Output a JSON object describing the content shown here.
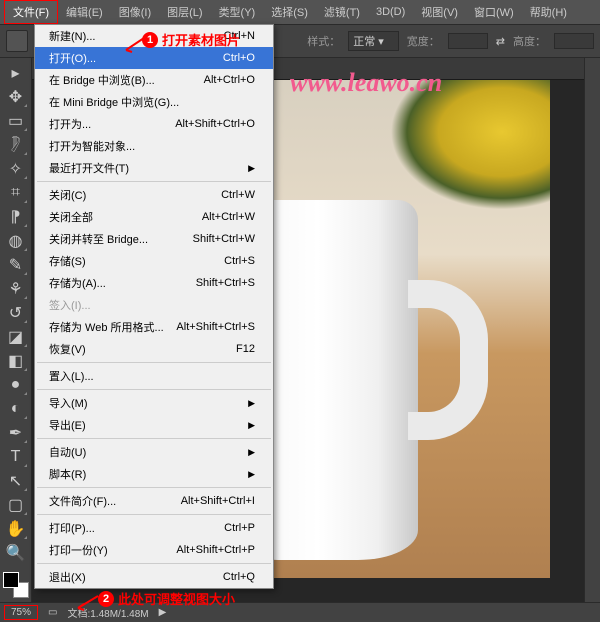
{
  "menubar": {
    "items": [
      "文件(F)",
      "编辑(E)",
      "图像(I)",
      "图层(L)",
      "类型(Y)",
      "选择(S)",
      "滤镜(T)",
      "3D(D)",
      "视图(V)",
      "窗口(W)",
      "帮助(H)"
    ]
  },
  "optionbar": {
    "style_label": "样式：",
    "style_value": "正常",
    "width_label": "宽度：",
    "swap": "⇄",
    "height_label": "高度："
  },
  "dropdown": {
    "items": [
      {
        "label": "新建(N)...",
        "shortcut": "Ctrl+N"
      },
      {
        "label": "打开(O)...",
        "shortcut": "Ctrl+O",
        "highlighted": true
      },
      {
        "label": "在 Bridge 中浏览(B)...",
        "shortcut": "Alt+Ctrl+O"
      },
      {
        "label": "在 Mini Bridge 中浏览(G)..."
      },
      {
        "label": "打开为...",
        "shortcut": "Alt+Shift+Ctrl+O"
      },
      {
        "label": "打开为智能对象..."
      },
      {
        "label": "最近打开文件(T)",
        "submenu": true
      },
      {
        "sep": true
      },
      {
        "label": "关闭(C)",
        "shortcut": "Ctrl+W"
      },
      {
        "label": "关闭全部",
        "shortcut": "Alt+Ctrl+W"
      },
      {
        "label": "关闭并转至 Bridge...",
        "shortcut": "Shift+Ctrl+W"
      },
      {
        "label": "存储(S)",
        "shortcut": "Ctrl+S"
      },
      {
        "label": "存储为(A)...",
        "shortcut": "Shift+Ctrl+S"
      },
      {
        "label": "签入(I)...",
        "disabled": true
      },
      {
        "label": "存储为 Web 所用格式...",
        "shortcut": "Alt+Shift+Ctrl+S"
      },
      {
        "label": "恢复(V)",
        "shortcut": "F12"
      },
      {
        "sep": true
      },
      {
        "label": "置入(L)..."
      },
      {
        "sep": true
      },
      {
        "label": "导入(M)",
        "submenu": true
      },
      {
        "label": "导出(E)",
        "submenu": true
      },
      {
        "sep": true
      },
      {
        "label": "自动(U)",
        "submenu": true
      },
      {
        "label": "脚本(R)",
        "submenu": true
      },
      {
        "sep": true
      },
      {
        "label": "文件简介(F)...",
        "shortcut": "Alt+Shift+Ctrl+I"
      },
      {
        "sep": true
      },
      {
        "label": "打印(P)...",
        "shortcut": "Ctrl+P"
      },
      {
        "label": "打印一份(Y)",
        "shortcut": "Alt+Shift+Ctrl+P"
      },
      {
        "sep": true
      },
      {
        "label": "退出(X)",
        "shortcut": "Ctrl+Q"
      }
    ]
  },
  "watermark": "www.leawo.cn",
  "callouts": {
    "c1_num": "1",
    "c1_text": "打开素材图片",
    "c2_num": "2",
    "c2_text": "此处可调整视图大小"
  },
  "statusbar": {
    "zoom": "75%",
    "doc_label": "文档:",
    "doc_info": "1.48M/1.48M",
    "arrow": "▶"
  },
  "tools": [
    "move",
    "marquee",
    "lasso",
    "wand",
    "crop",
    "eyedropper",
    "heal",
    "brush",
    "stamp",
    "history",
    "eraser",
    "gradient",
    "blur",
    "dodge",
    "pen",
    "type",
    "path",
    "rect",
    "hand",
    "zoom"
  ]
}
